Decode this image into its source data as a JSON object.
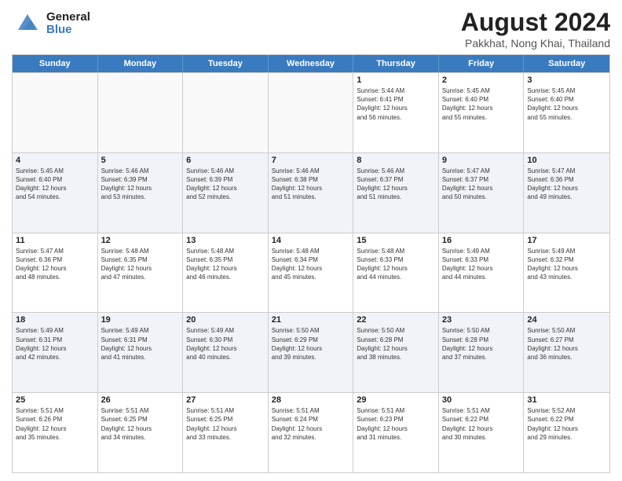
{
  "header": {
    "logo_general": "General",
    "logo_blue": "Blue",
    "title": "August 2024",
    "subtitle": "Pakkhat, Nong Khai, Thailand"
  },
  "days": [
    "Sunday",
    "Monday",
    "Tuesday",
    "Wednesday",
    "Thursday",
    "Friday",
    "Saturday"
  ],
  "rows": [
    [
      {
        "day": "",
        "info": "",
        "empty": true
      },
      {
        "day": "",
        "info": "",
        "empty": true
      },
      {
        "day": "",
        "info": "",
        "empty": true
      },
      {
        "day": "",
        "info": "",
        "empty": true
      },
      {
        "day": "1",
        "info": "Sunrise: 5:44 AM\nSunset: 6:41 PM\nDaylight: 12 hours\nand 56 minutes."
      },
      {
        "day": "2",
        "info": "Sunrise: 5:45 AM\nSunset: 6:40 PM\nDaylight: 12 hours\nand 55 minutes."
      },
      {
        "day": "3",
        "info": "Sunrise: 5:45 AM\nSunset: 6:40 PM\nDaylight: 12 hours\nand 55 minutes."
      }
    ],
    [
      {
        "day": "4",
        "info": "Sunrise: 5:45 AM\nSunset: 6:40 PM\nDaylight: 12 hours\nand 54 minutes."
      },
      {
        "day": "5",
        "info": "Sunrise: 5:46 AM\nSunset: 6:39 PM\nDaylight: 12 hours\nand 53 minutes."
      },
      {
        "day": "6",
        "info": "Sunrise: 5:46 AM\nSunset: 6:39 PM\nDaylight: 12 hours\nand 52 minutes."
      },
      {
        "day": "7",
        "info": "Sunrise: 5:46 AM\nSunset: 6:38 PM\nDaylight: 12 hours\nand 51 minutes."
      },
      {
        "day": "8",
        "info": "Sunrise: 5:46 AM\nSunset: 6:37 PM\nDaylight: 12 hours\nand 51 minutes."
      },
      {
        "day": "9",
        "info": "Sunrise: 5:47 AM\nSunset: 6:37 PM\nDaylight: 12 hours\nand 50 minutes."
      },
      {
        "day": "10",
        "info": "Sunrise: 5:47 AM\nSunset: 6:36 PM\nDaylight: 12 hours\nand 49 minutes."
      }
    ],
    [
      {
        "day": "11",
        "info": "Sunrise: 5:47 AM\nSunset: 6:36 PM\nDaylight: 12 hours\nand 48 minutes."
      },
      {
        "day": "12",
        "info": "Sunrise: 5:48 AM\nSunset: 6:35 PM\nDaylight: 12 hours\nand 47 minutes."
      },
      {
        "day": "13",
        "info": "Sunrise: 5:48 AM\nSunset: 6:35 PM\nDaylight: 12 hours\nand 46 minutes."
      },
      {
        "day": "14",
        "info": "Sunrise: 5:48 AM\nSunset: 6:34 PM\nDaylight: 12 hours\nand 45 minutes."
      },
      {
        "day": "15",
        "info": "Sunrise: 5:48 AM\nSunset: 6:33 PM\nDaylight: 12 hours\nand 44 minutes."
      },
      {
        "day": "16",
        "info": "Sunrise: 5:49 AM\nSunset: 6:33 PM\nDaylight: 12 hours\nand 44 minutes."
      },
      {
        "day": "17",
        "info": "Sunrise: 5:49 AM\nSunset: 6:32 PM\nDaylight: 12 hours\nand 43 minutes."
      }
    ],
    [
      {
        "day": "18",
        "info": "Sunrise: 5:49 AM\nSunset: 6:31 PM\nDaylight: 12 hours\nand 42 minutes."
      },
      {
        "day": "19",
        "info": "Sunrise: 5:49 AM\nSunset: 6:31 PM\nDaylight: 12 hours\nand 41 minutes."
      },
      {
        "day": "20",
        "info": "Sunrise: 5:49 AM\nSunset: 6:30 PM\nDaylight: 12 hours\nand 40 minutes."
      },
      {
        "day": "21",
        "info": "Sunrise: 5:50 AM\nSunset: 6:29 PM\nDaylight: 12 hours\nand 39 minutes."
      },
      {
        "day": "22",
        "info": "Sunrise: 5:50 AM\nSunset: 6:28 PM\nDaylight: 12 hours\nand 38 minutes."
      },
      {
        "day": "23",
        "info": "Sunrise: 5:50 AM\nSunset: 6:28 PM\nDaylight: 12 hours\nand 37 minutes."
      },
      {
        "day": "24",
        "info": "Sunrise: 5:50 AM\nSunset: 6:27 PM\nDaylight: 12 hours\nand 36 minutes."
      }
    ],
    [
      {
        "day": "25",
        "info": "Sunrise: 5:51 AM\nSunset: 6:26 PM\nDaylight: 12 hours\nand 35 minutes."
      },
      {
        "day": "26",
        "info": "Sunrise: 5:51 AM\nSunset: 6:25 PM\nDaylight: 12 hours\nand 34 minutes."
      },
      {
        "day": "27",
        "info": "Sunrise: 5:51 AM\nSunset: 6:25 PM\nDaylight: 12 hours\nand 33 minutes."
      },
      {
        "day": "28",
        "info": "Sunrise: 5:51 AM\nSunset: 6:24 PM\nDaylight: 12 hours\nand 32 minutes."
      },
      {
        "day": "29",
        "info": "Sunrise: 5:51 AM\nSunset: 6:23 PM\nDaylight: 12 hours\nand 31 minutes."
      },
      {
        "day": "30",
        "info": "Sunrise: 5:51 AM\nSunset: 6:22 PM\nDaylight: 12 hours\nand 30 minutes."
      },
      {
        "day": "31",
        "info": "Sunrise: 5:52 AM\nSunset: 6:22 PM\nDaylight: 12 hours\nand 29 minutes."
      }
    ]
  ]
}
